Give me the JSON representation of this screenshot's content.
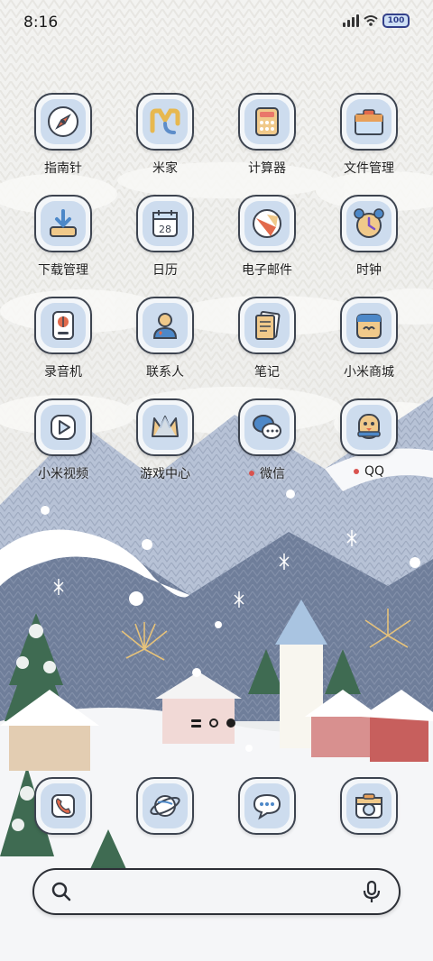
{
  "status_bar": {
    "time": "8:16",
    "battery": "100"
  },
  "apps": [
    {
      "label": "指南针",
      "icon": "compass-icon",
      "notification": false
    },
    {
      "label": "米家",
      "icon": "mijia-icon",
      "notification": false
    },
    {
      "label": "计算器",
      "icon": "calculator-icon",
      "notification": false
    },
    {
      "label": "文件管理",
      "icon": "folder-icon",
      "notification": false
    },
    {
      "label": "下载管理",
      "icon": "download-icon",
      "notification": false
    },
    {
      "label": "日历",
      "icon": "calendar-icon",
      "notification": false,
      "day": "28"
    },
    {
      "label": "电子邮件",
      "icon": "mail-icon",
      "notification": false
    },
    {
      "label": "时钟",
      "icon": "alarm-clock-icon",
      "notification": false
    },
    {
      "label": "录音机",
      "icon": "recorder-icon",
      "notification": false
    },
    {
      "label": "联系人",
      "icon": "contacts-icon",
      "notification": false
    },
    {
      "label": "笔记",
      "icon": "notes-icon",
      "notification": false
    },
    {
      "label": "小米商城",
      "icon": "mi-store-icon",
      "notification": false
    },
    {
      "label": "小米视频",
      "icon": "video-play-icon",
      "notification": false
    },
    {
      "label": "游戏中心",
      "icon": "game-crown-icon",
      "notification": false
    },
    {
      "label": "微信",
      "icon": "wechat-icon",
      "notification": true
    },
    {
      "label": "QQ",
      "icon": "qq-penguin-icon",
      "notification": true
    }
  ],
  "dock": [
    {
      "icon": "phone-icon"
    },
    {
      "icon": "browser-planet-icon"
    },
    {
      "icon": "messages-icon"
    },
    {
      "icon": "camera-icon"
    }
  ],
  "page_indicator": {
    "pages": 2,
    "current": 2
  },
  "colors": {
    "icon_fill": "#cddcee",
    "icon_border": "#3d4450",
    "notification_dot": "#d9534f"
  }
}
